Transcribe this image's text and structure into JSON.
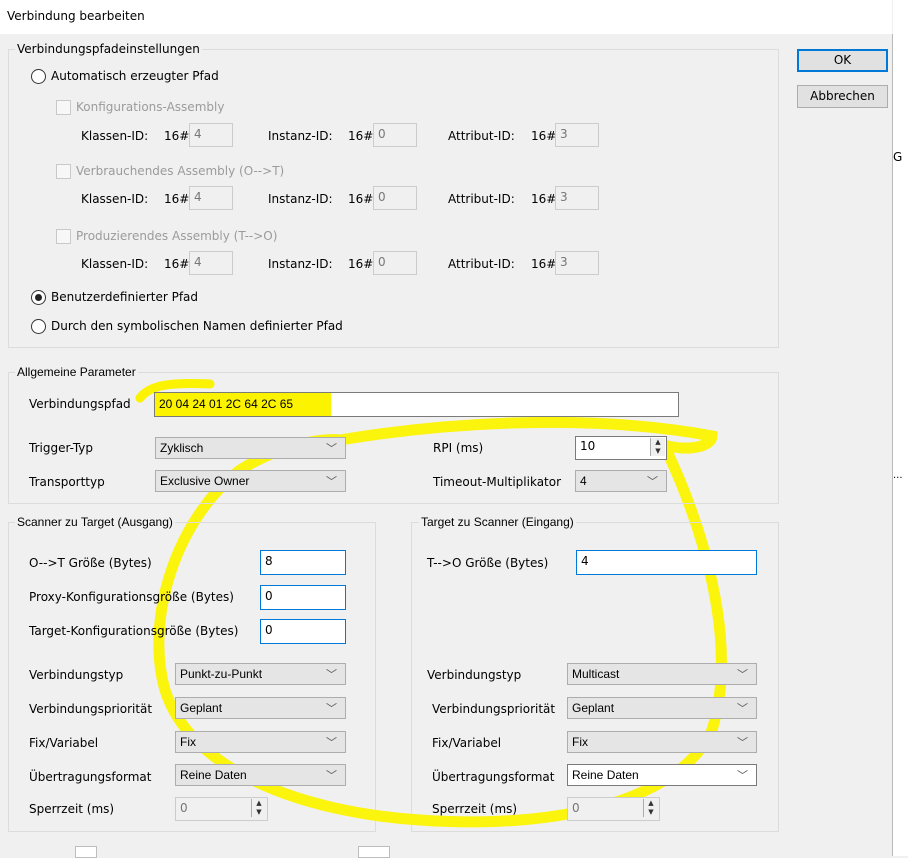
{
  "window": {
    "title": "Verbindung bearbeiten"
  },
  "buttons": {
    "ok": "OK",
    "cancel": "Abbrechen"
  },
  "path_settings": {
    "group_label": "Verbindungspfadeinstellungen",
    "auto_path": "Automatisch erzeugter Pfad",
    "assemblies": [
      {
        "label": "Konfigurations-Assembly",
        "class_label": "Klassen-ID:",
        "class_prefix": "16#",
        "class_val": "4",
        "inst_label": "Instanz-ID:",
        "inst_prefix": "16#",
        "inst_val": "0",
        "attr_label": "Attribut-ID:",
        "attr_prefix": "16#",
        "attr_val": "3"
      },
      {
        "label": "Verbrauchendes Assembly (O-->T)",
        "class_label": "Klassen-ID:",
        "class_prefix": "16#",
        "class_val": "4",
        "inst_label": "Instanz-ID:",
        "inst_prefix": "16#",
        "inst_val": "0",
        "attr_label": "Attribut-ID:",
        "attr_prefix": "16#",
        "attr_val": "3"
      },
      {
        "label": "Produzierendes Assembly (T-->O)",
        "class_label": "Klassen-ID:",
        "class_prefix": "16#",
        "class_val": "4",
        "inst_label": "Instanz-ID:",
        "inst_prefix": "16#",
        "inst_val": "0",
        "attr_label": "Attribut-ID:",
        "attr_prefix": "16#",
        "attr_val": "3"
      }
    ],
    "user_path": "Benutzerdefinierter Pfad",
    "symbolic_path": "Durch den symbolischen Namen definierter Pfad",
    "selected": "user_path"
  },
  "general": {
    "group_label": "Allgemeine Parameter",
    "path_label": "Verbindungspfad",
    "path_value": "20 04 24 01 2C 64 2C 65",
    "trigger_label": "Trigger-Typ",
    "trigger_value": "Zyklisch",
    "transport_label": "Transporttyp",
    "transport_value": "Exclusive Owner",
    "rpi_label": "RPI (ms)",
    "rpi_value": "10",
    "timeout_label": "Timeout-Multiplikator",
    "timeout_value": "4"
  },
  "scanner_to_target": {
    "group_label": "Scanner zu Target (Ausgang)",
    "size_label": "O-->T Größe  (Bytes)",
    "size_value": "8",
    "proxy_label": "Proxy-Konfigurationsgröße (Bytes)",
    "proxy_value": "0",
    "target_cfg_label": "Target-Konfigurationsgröße (Bytes)",
    "target_cfg_value": "0",
    "conn_type_label": "Verbindungstyp",
    "conn_type_value": "Punkt-zu-Punkt",
    "priority_label": "Verbindungspriorität",
    "priority_value": "Geplant",
    "fixvar_label": "Fix/Variabel",
    "fixvar_value": "Fix",
    "format_label": "Übertragungsformat",
    "format_value": "Reine Daten",
    "inhibit_label": "Sperrzeit (ms)",
    "inhibit_value": "0"
  },
  "target_to_scanner": {
    "group_label": "Target zu Scanner (Eingang)",
    "size_label": "T-->O Größe (Bytes)",
    "size_value": "4",
    "conn_type_label": "Verbindungstyp",
    "conn_type_value": "Multicast",
    "priority_label": "Verbindungspriorität",
    "priority_value": "Geplant",
    "fixvar_label": "Fix/Variabel",
    "fixvar_value": "Fix",
    "format_label": "Übertragungsformat",
    "format_value": "Reine Daten",
    "inhibit_label": "Sperrzeit (ms)",
    "inhibit_value": "0"
  },
  "background": {
    "g_letter": "G",
    "ellipsis": "..."
  },
  "colors": {
    "highlight": "#fbf300",
    "focus_blue": "#0078d7"
  }
}
